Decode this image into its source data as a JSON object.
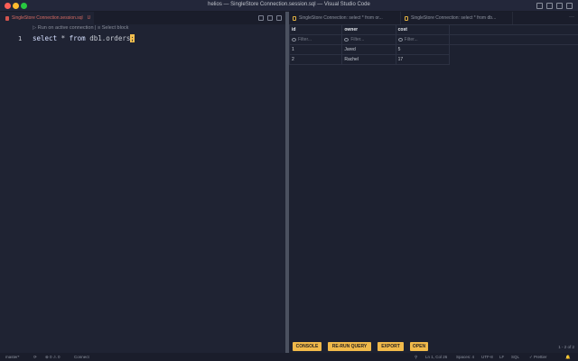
{
  "window": {
    "title": "helios — SingleStore Connection.session.sql — Visual Studio Code"
  },
  "editor": {
    "tab": {
      "label": "SingleStore Connection.session.sql",
      "modified": "U"
    },
    "codelens": "▷ Run on active connection | ≡ Select block",
    "line_number": "1",
    "code": {
      "kw1": "select",
      "star": " * ",
      "kw2": "from",
      "rest": " db1.orders",
      "last": ";"
    }
  },
  "results": {
    "tabs": [
      {
        "label": "SingleStore Connection: select * from or..."
      },
      {
        "label": "SingleStore Connection: select * from db..."
      }
    ],
    "more": "···",
    "columns": [
      "id",
      "owner",
      "cost"
    ],
    "filter_placeholder": "Filter...",
    "rows": [
      [
        "1",
        "Jared",
        "5"
      ],
      [
        "2",
        "Rachel",
        "17"
      ]
    ],
    "buttons": {
      "console": "CONSOLE",
      "rerun": "RE-RUN QUERY",
      "export": "EXPORT",
      "open": "OPEN"
    },
    "pager": "1 - 2 of 2"
  },
  "statusbar": {
    "branch": "master*",
    "sync": "⟳",
    "problems": "⊗ 0 ⚠ 0",
    "connect": "Connect",
    "notif": "⚲",
    "position": "Ln 1, Col 26",
    "spaces": "Spaces: 4",
    "encoding": "UTF-8",
    "eol": "LF",
    "lang": "SQL",
    "prettier": "✓ Prettier",
    "bell": "🔔"
  },
  "colors": {
    "accent": "#f0b94a",
    "background": "#1e2230",
    "file_icon": "#d2544f"
  }
}
